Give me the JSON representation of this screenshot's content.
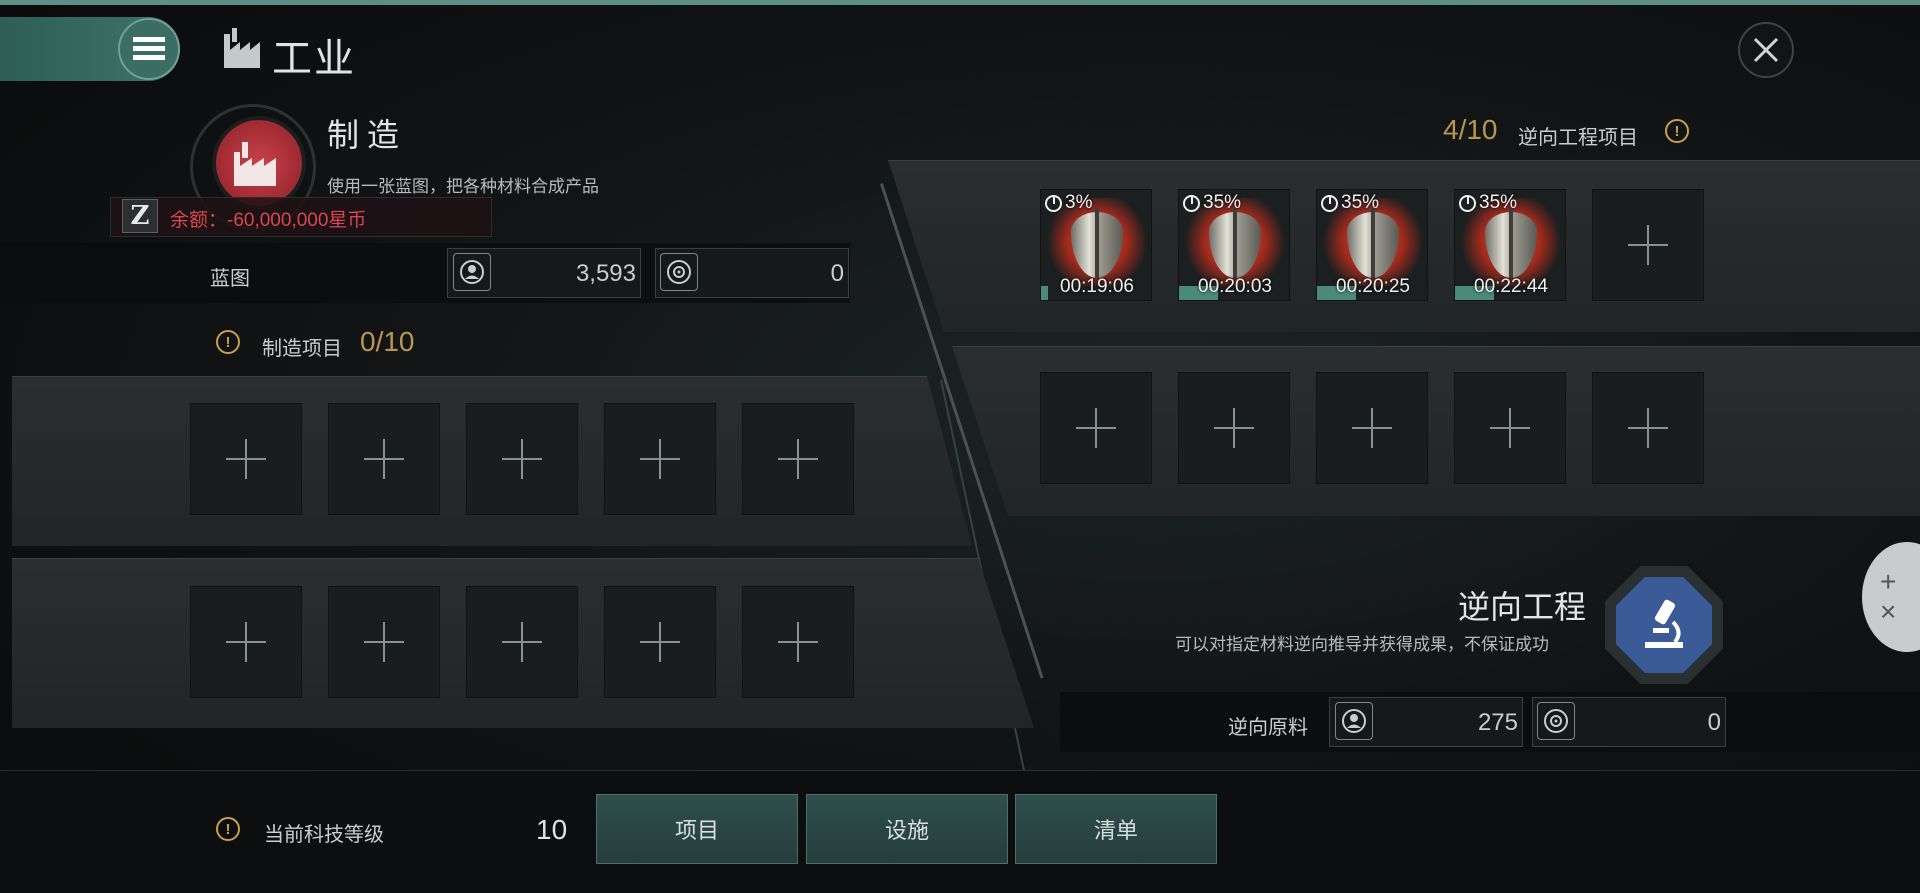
{
  "header": {
    "title": "工业"
  },
  "manufacturing": {
    "title": "制造",
    "description": "使用一张蓝图，把各种材料合成产品",
    "balance": "余额：-60,000,000星币",
    "blueprint_label": "蓝图",
    "blueprint_personal": "3,593",
    "blueprint_corp": "0",
    "jobs_label": "制造项目",
    "jobs_count": "0/10"
  },
  "reverse_engineering": {
    "jobs_count": "4/10",
    "jobs_label": "逆向工程项目",
    "jobs": [
      {
        "percent": "3%",
        "time": "00:19:06",
        "progress": 0.03
      },
      {
        "percent": "35%",
        "time": "00:20:03",
        "progress": 0.35
      },
      {
        "percent": "35%",
        "time": "00:20:25",
        "progress": 0.35
      },
      {
        "percent": "35%",
        "time": "00:22:44",
        "progress": 0.35
      }
    ],
    "title": "逆向工程",
    "description": "可以对指定材料逆向推导并获得成果，不保证成功",
    "material_label": "逆向原料",
    "material_personal": "275",
    "material_corp": "0"
  },
  "footer": {
    "tech_label": "当前科技等级",
    "tech_level": "10",
    "buttons": [
      "项目",
      "设施",
      "清单"
    ]
  },
  "side_tab": {
    "plus": "+",
    "close": "×"
  }
}
